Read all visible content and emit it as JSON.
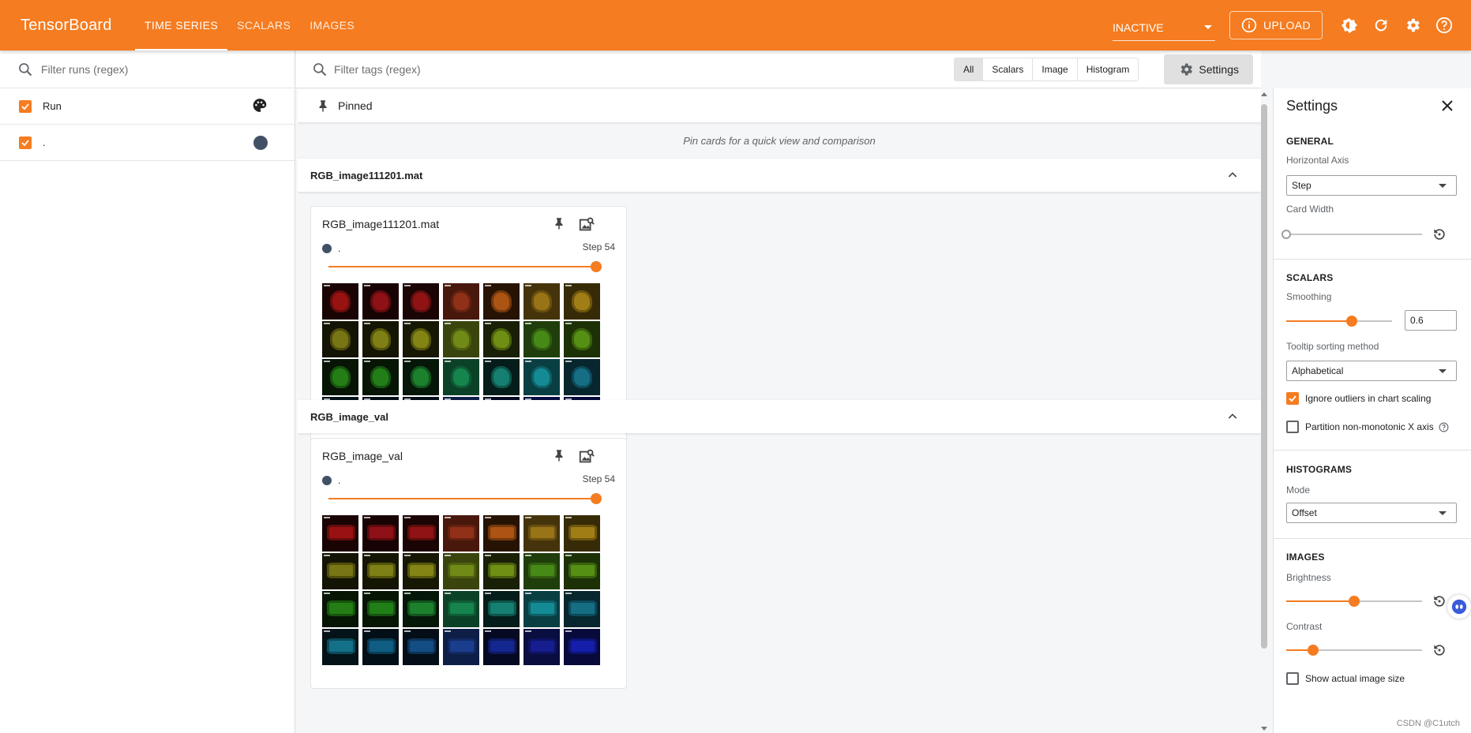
{
  "app": {
    "title": "TensorBoard"
  },
  "tabs": [
    "TIME SERIES",
    "SCALARS",
    "IMAGES"
  ],
  "header": {
    "status": "INACTIVE",
    "upload_label": "UPLOAD"
  },
  "sidebar": {
    "filter_placeholder": "Filter runs (regex)",
    "runs": [
      {
        "label": "Run"
      },
      {
        "label": "."
      }
    ]
  },
  "main": {
    "filter_placeholder": "Filter tags (regex)",
    "type_chips": [
      "All",
      "Scalars",
      "Image",
      "Histogram"
    ],
    "settings_label": "Settings",
    "pinned_title": "Pinned",
    "pinned_message": "Pin cards for a quick view and comparison",
    "groups": [
      {
        "title": "RGB_image111201.mat",
        "card_title": "RGB_image111201.mat",
        "run": ".",
        "step_text": "Step 54"
      },
      {
        "title": "RGB_image_val",
        "card_title": "RGB_image_val",
        "run": ".",
        "step_text": "Step 54"
      }
    ]
  },
  "settings_panel": {
    "title": "Settings",
    "general": {
      "heading": "GENERAL",
      "horizontal_axis_label": "Horizontal Axis",
      "horizontal_axis_value": "Step",
      "card_width_label": "Card Width",
      "card_width_level": 0
    },
    "scalars": {
      "heading": "SCALARS",
      "smoothing_label": "Smoothing",
      "smoothing_value": "0.6",
      "tooltip_label": "Tooltip sorting method",
      "tooltip_value": "Alphabetical",
      "ignore_outliers_label": "Ignore outliers in chart scaling",
      "ignore_outliers_checked": true,
      "partition_label": "Partition non-monotonic X axis",
      "partition_checked": false
    },
    "histograms": {
      "heading": "HISTOGRAMS",
      "mode_label": "Mode",
      "mode_value": "Offset"
    },
    "images": {
      "heading": "IMAGES",
      "brightness_label": "Brightness",
      "brightness_level": 0.5,
      "contrast_label": "Contrast",
      "contrast_level": 0.2,
      "actual_size_label": "Show actual image size",
      "actual_size_checked": false
    }
  },
  "footer": {
    "watermark": "CSDN @C1utch"
  },
  "colors": {
    "brand": "#f57c20",
    "run_dot": "#425066"
  },
  "tiles": [
    "#c41818",
    "#b5161c",
    "#b7191a",
    "#a8381c",
    "#d96a18",
    "#b68a1c",
    "#c49a1a",
    "#9a961b",
    "#a1a31a",
    "#a7a819",
    "#84a11b",
    "#8cb319",
    "#55a31c",
    "#68b019",
    "#2ea11b",
    "#2ca31f",
    "#24a43a",
    "#1a9a5a",
    "#1ba08e",
    "#18a5b0",
    "#1a86a2",
    "#1a8fae",
    "#1477a8",
    "#1a62a8",
    "#1f47a6",
    "#1930b5",
    "#1a23a8",
    "#1a25d0"
  ]
}
